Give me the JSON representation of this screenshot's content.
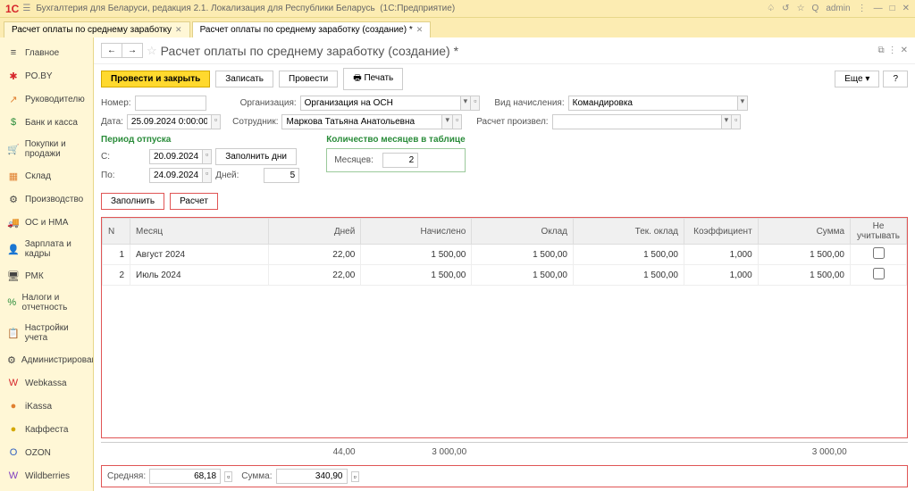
{
  "titlebar": {
    "app_name": "Бухгалтерия для Беларуси, редакция 2.1. Локализация для Республики Беларусь",
    "platform": "(1С:Предприятие)",
    "user": "admin"
  },
  "tabs": [
    {
      "label": "Расчет оплаты по среднему заработку",
      "active": false
    },
    {
      "label": "Расчет оплаты по среднему заработку (создание) *",
      "active": true
    }
  ],
  "sidebar": {
    "items": [
      {
        "label": "Главное",
        "icon": "≡",
        "cls": ""
      },
      {
        "label": "PO.BY",
        "icon": "✱",
        "cls": "icon-red"
      },
      {
        "label": "Руководителю",
        "icon": "↗",
        "cls": "icon-orange"
      },
      {
        "label": "Банк и касса",
        "icon": "$",
        "cls": "icon-green"
      },
      {
        "label": "Покупки и продажи",
        "icon": "🛒",
        "cls": ""
      },
      {
        "label": "Склад",
        "icon": "▦",
        "cls": "icon-orange"
      },
      {
        "label": "Производство",
        "icon": "⚙",
        "cls": ""
      },
      {
        "label": "ОС и НМА",
        "icon": "🚚",
        "cls": ""
      },
      {
        "label": "Зарплата и кадры",
        "icon": "👤",
        "cls": ""
      },
      {
        "label": "РМК",
        "icon": "🖥",
        "cls": ""
      },
      {
        "label": "Налоги и отчетность",
        "icon": "%",
        "cls": "icon-green"
      },
      {
        "label": "Настройки учета",
        "icon": "📋",
        "cls": ""
      },
      {
        "label": "Администрирование",
        "icon": "⚙",
        "cls": ""
      },
      {
        "label": "Webkassa",
        "icon": "W",
        "cls": "icon-red"
      },
      {
        "label": "iKassa",
        "icon": "●",
        "cls": "icon-orange"
      },
      {
        "label": "Каффеста",
        "icon": "●",
        "cls": "icon-yellow"
      },
      {
        "label": "OZON",
        "icon": "O",
        "cls": "icon-blue"
      },
      {
        "label": "Wildberries",
        "icon": "W",
        "cls": "icon-purple"
      }
    ]
  },
  "page": {
    "title": "Расчет оплаты по среднему заработку (создание) *"
  },
  "toolbar": {
    "post_close": "Провести и закрыть",
    "write": "Записать",
    "post": "Провести",
    "print": "Печать",
    "more": "Еще",
    "help": "?"
  },
  "form": {
    "number_label": "Номер:",
    "number": "",
    "org_label": "Организация:",
    "org": "Организация на ОСН",
    "kind_label": "Вид начисления:",
    "kind": "Командировка",
    "date_label": "Дата:",
    "date": "25.09.2024 0:00:00",
    "employee_label": "Сотрудник:",
    "employee": "Маркова Татьяна Анатольевна",
    "calc_done_label": "Расчет произвел:",
    "calc_done": ""
  },
  "period": {
    "title": "Период отпуска",
    "from_label": "С:",
    "from": "20.09.2024",
    "to_label": "По:",
    "to": "24.09.2024",
    "fill_days": "Заполнить дни",
    "days_label": "Дней:",
    "days": "5"
  },
  "months": {
    "title": "Количество месяцев в таблице",
    "label": "Месяцев:",
    "value": "2"
  },
  "actions": {
    "fill": "Заполнить",
    "calc": "Расчет"
  },
  "table": {
    "headers": {
      "n": "N",
      "month": "Месяц",
      "days": "Дней",
      "accrued": "Начислено",
      "salary": "Оклад",
      "cur_salary": "Тек. оклад",
      "coef": "Коэффициент",
      "sum": "Сумма",
      "exclude": "Не учитывать"
    },
    "rows": [
      {
        "n": "1",
        "month": "Август 2024",
        "days": "22,00",
        "accrued": "1 500,00",
        "salary": "1 500,00",
        "cur_salary": "1 500,00",
        "coef": "1,000",
        "sum": "1 500,00"
      },
      {
        "n": "2",
        "month": "Июль 2024",
        "days": "22,00",
        "accrued": "1 500,00",
        "salary": "1 500,00",
        "cur_salary": "1 500,00",
        "coef": "1,000",
        "sum": "1 500,00"
      }
    ],
    "totals": {
      "days": "44,00",
      "accrued": "3 000,00",
      "sum": "3 000,00"
    }
  },
  "footer": {
    "avg_label": "Средняя:",
    "avg": "68,18",
    "sum_label": "Сумма:",
    "sum": "340,90"
  }
}
